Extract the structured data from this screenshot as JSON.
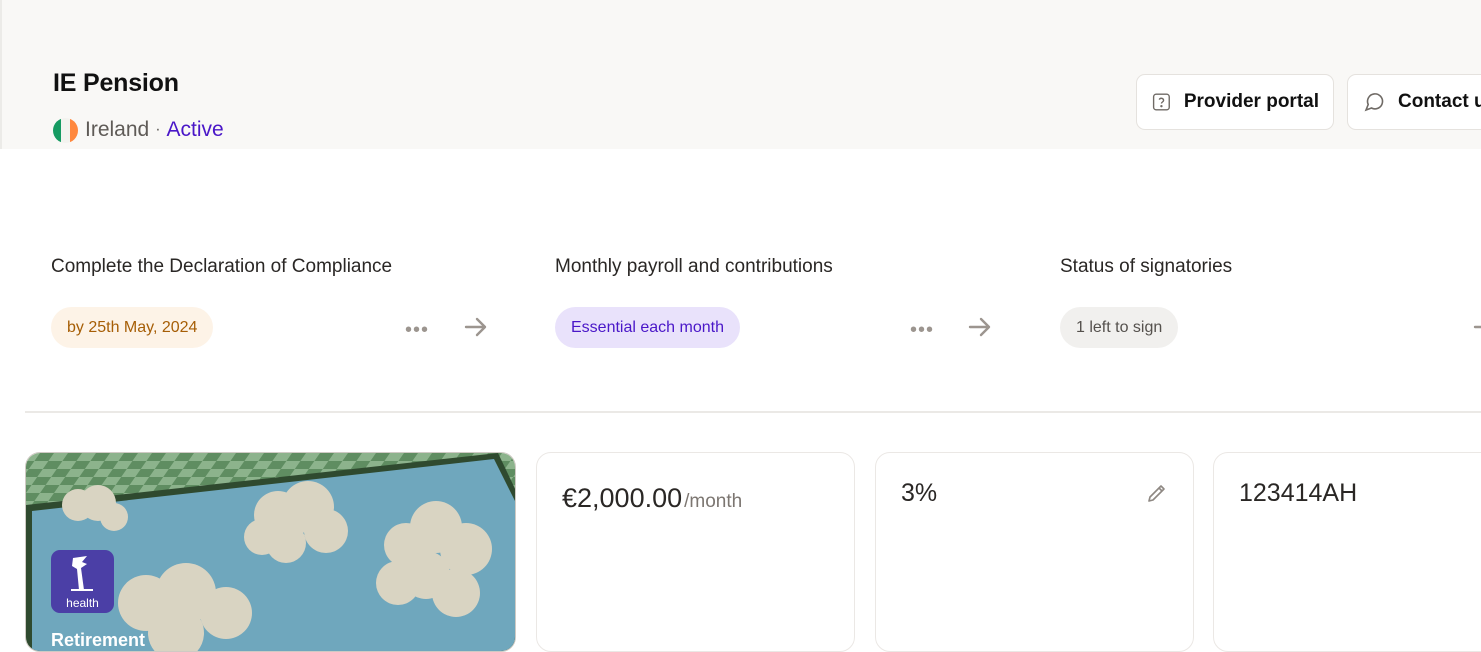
{
  "header": {
    "title": "IE Pension",
    "country": "Ireland",
    "separator": "·",
    "status": "Active",
    "buttons": {
      "provider_portal": "Provider portal",
      "contact": "Contact u"
    }
  },
  "tasks": [
    {
      "title": "Complete the Declaration of Compliance",
      "pill": "by 25th May, 2024",
      "more": "•••"
    },
    {
      "title": "Monthly payroll and contributions",
      "pill": "Essential each month",
      "more": "•••"
    },
    {
      "title": "Status of signatories",
      "pill": "1 left to sign"
    }
  ],
  "cards": {
    "amount": "€2,000.00",
    "amount_unit": "/month",
    "percentage": "3%",
    "scheme_id": "123414AH",
    "logo_text": "health",
    "image_caption": "Retirement"
  },
  "colors": {
    "accent": "#4a17c8",
    "orange_pill_bg": "#fdf3e7",
    "orange_pill_text": "#a65e06",
    "purple_pill_bg": "#e9e2fb",
    "grey_pill_bg": "#f1f0ee"
  },
  "icons": [
    "question-icon",
    "chat-icon",
    "more-icon",
    "arrow-right-icon",
    "pencil-icon",
    "ireland-flag-icon",
    "provider-logo-icon"
  ]
}
